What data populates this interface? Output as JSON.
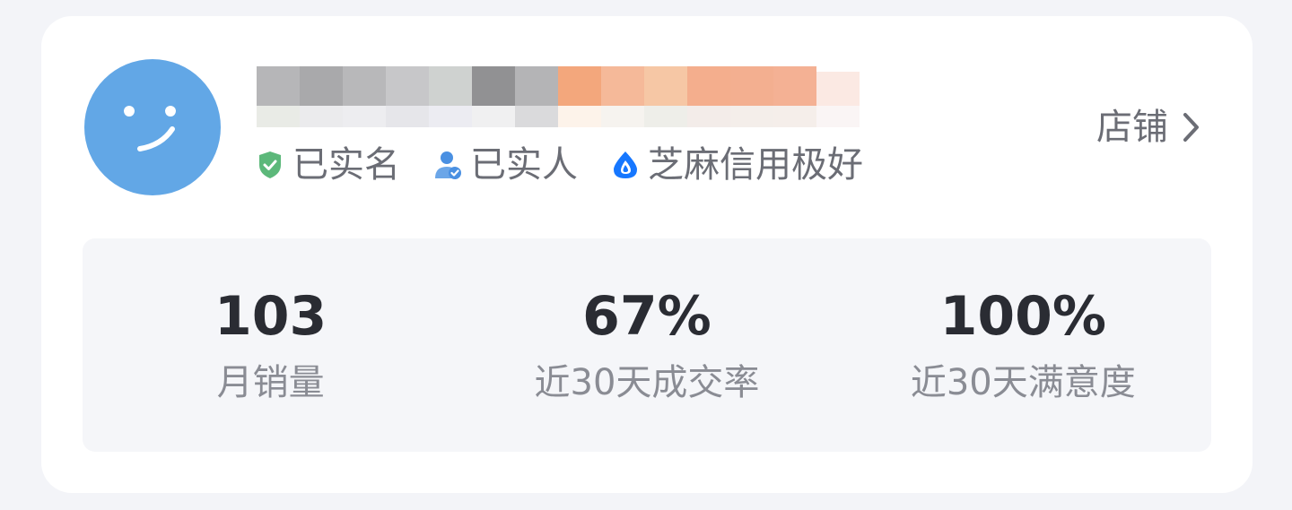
{
  "seller": {
    "avatar_icon": "smiley-face-avatar",
    "name_redacted": true,
    "badges": [
      {
        "icon": "shield-check-icon",
        "label": "已实名",
        "color": "#5cb87a"
      },
      {
        "icon": "person-check-icon",
        "label": "已实人",
        "color": "#4a90e2"
      },
      {
        "icon": "sesame-credit-icon",
        "label": "芝麻信用极好",
        "color": "#1677ff"
      }
    ]
  },
  "shop_link": {
    "label": "店铺",
    "icon": "chevron-right-icon"
  },
  "stats": [
    {
      "value": "103",
      "label": "月销量"
    },
    {
      "value": "67%",
      "label": "近30天成交率"
    },
    {
      "value": "100%",
      "label": "近30天满意度"
    }
  ],
  "colors": {
    "avatar_bg": "#62a7e6",
    "page_bg": "#f3f4f8",
    "stats_bg": "#f5f6f9"
  }
}
